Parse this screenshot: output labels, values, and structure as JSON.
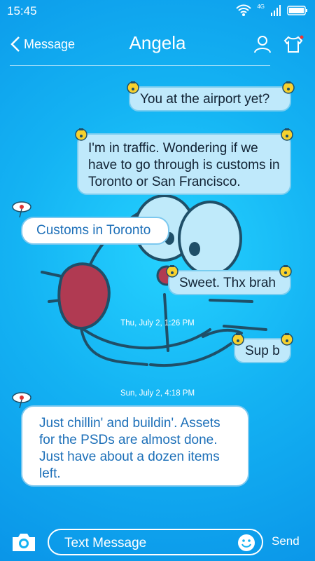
{
  "status": {
    "time": "15:45",
    "network": "4G"
  },
  "header": {
    "back_label": "Message",
    "title": "Angela"
  },
  "messages": [
    {
      "dir": "out",
      "text": "You at the airport yet?"
    },
    {
      "dir": "out",
      "text": "I'm in traffic. Wondering if we have to go through is customs in Toronto or San Francisco."
    },
    {
      "dir": "in",
      "text": "Customs in Toronto"
    },
    {
      "dir": "out",
      "text": "Sweet. Thx brah"
    },
    {
      "dir": "out",
      "text": "Sup b"
    },
    {
      "dir": "in",
      "text": "Just chillin' and buildin'. Assets for the PSDs are almost done. Just have about a dozen items left."
    }
  ],
  "timestamps": [
    "Thu, July 2, 1:26 PM",
    "Sun, July 2, 4:18 PM"
  ],
  "composer": {
    "placeholder": "Text Message",
    "send_label": "Send"
  },
  "colors": {
    "accent": "#14b3f3",
    "outgoing_bubble": "#bfe9fb",
    "incoming_text": "#1c6fb8",
    "notification_dot": "#e33"
  },
  "icons": [
    "wifi-icon",
    "signal-icon",
    "battery-icon",
    "back-chevron-icon",
    "contact-icon",
    "tshirt-icon",
    "bell-icon",
    "tag-icon",
    "camera-icon",
    "emoji-icon"
  ]
}
